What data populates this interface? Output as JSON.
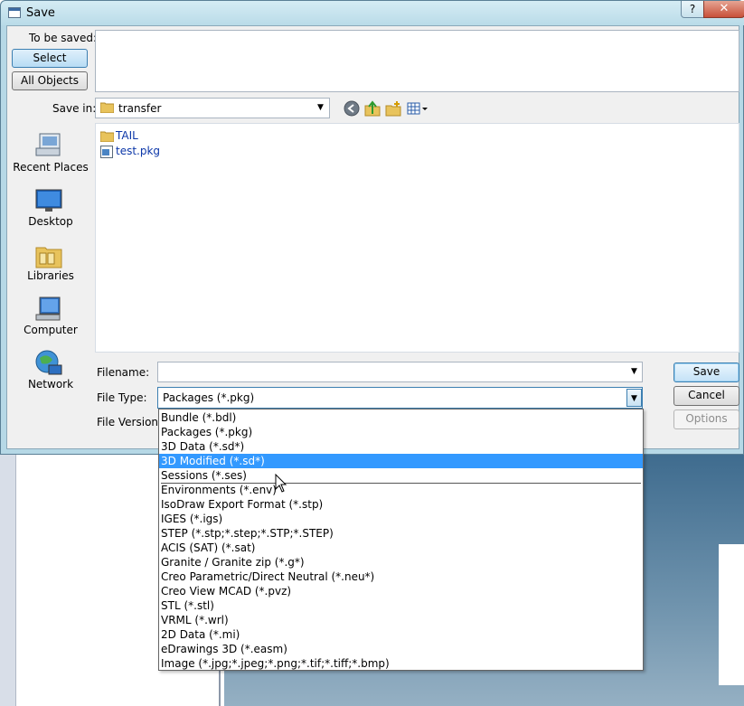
{
  "window": {
    "title": "Save",
    "help_label": "?",
    "close_label": "✕"
  },
  "tobesaved": {
    "label": "To be saved:",
    "select_label": "Select",
    "all_objects_label": "All Objects"
  },
  "savein": {
    "label": "Save in:",
    "value": "transfer"
  },
  "places": [
    {
      "label": "Recent Places",
      "icon": "recent-places-icon"
    },
    {
      "label": "Desktop",
      "icon": "desktop-icon"
    },
    {
      "label": "Libraries",
      "icon": "libraries-icon"
    },
    {
      "label": "Computer",
      "icon": "computer-icon"
    },
    {
      "label": "Network",
      "icon": "network-icon"
    }
  ],
  "files": [
    {
      "name": "TAIL",
      "icon": "folder-icon"
    },
    {
      "name": "test.pkg",
      "icon": "package-file-icon"
    }
  ],
  "form": {
    "filename_label": "Filename:",
    "filename_value": "",
    "filetype_label": "File Type:",
    "filetype_value": "Packages (*.pkg)",
    "fileversion_label": "File Version:"
  },
  "buttons": {
    "save": "Save",
    "cancel": "Cancel",
    "options": "Options"
  },
  "dropdown": {
    "selected_index": 3,
    "separator_after_index": 4,
    "options": [
      "Bundle (*.bdl)",
      "Packages (*.pkg)",
      "3D Data (*.sd*)",
      "3D Modified (*.sd*)",
      "Sessions (*.ses)",
      "Environments (*.env)",
      "IsoDraw Export Format (*.stp)",
      "IGES (*.igs)",
      "STEP (*.stp;*.step;*.STP;*.STEP)",
      "ACIS (SAT) (*.sat)",
      "Granite / Granite zip (*.g*)",
      "Creo Parametric/Direct Neutral (*.neu*)",
      "Creo View MCAD (*.pvz)",
      "STL (*.stl)",
      "VRML (*.wrl)",
      "2D Data (*.mi)",
      "eDrawings 3D (*.easm)",
      "Image (*.jpg;*.jpeg;*.png;*.tif;*.tiff;*.bmp)"
    ]
  },
  "colors": {
    "selection": "#3399ff",
    "title_bar": "#b9dbe8",
    "link_text": "#0b36a8"
  }
}
